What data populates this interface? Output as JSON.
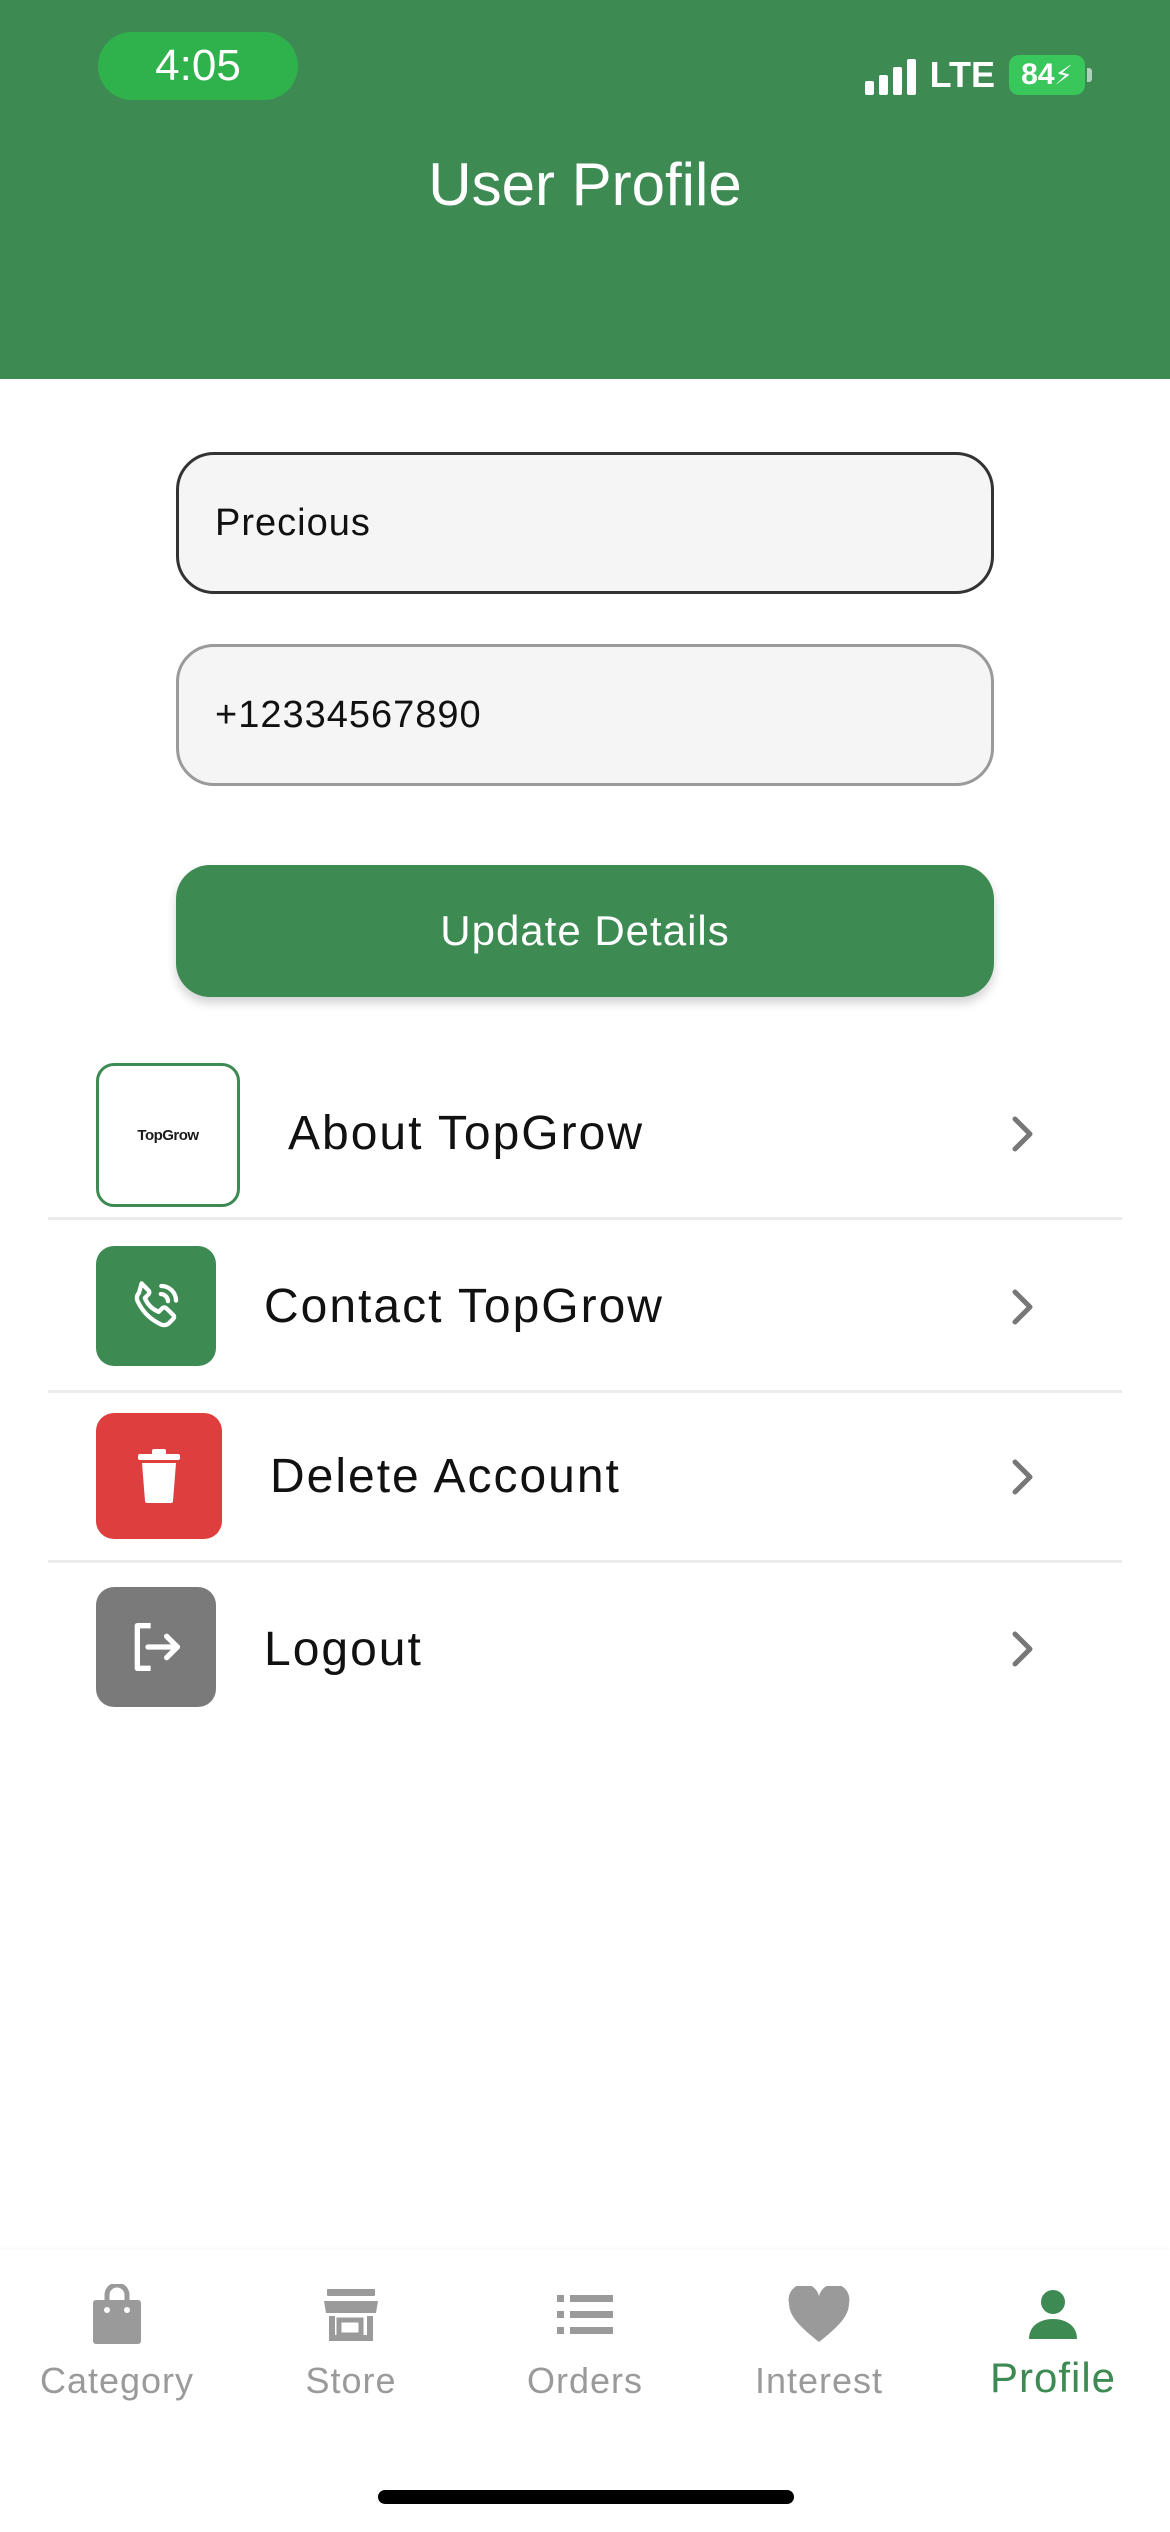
{
  "status_bar": {
    "time": "4:05",
    "network": "LTE",
    "battery": "84"
  },
  "header": {
    "title": "User Profile"
  },
  "form": {
    "name_value": "Precious",
    "phone_value": "+12334567890",
    "update_label": "Update Details"
  },
  "menu": {
    "about": {
      "label": "About TopGrow",
      "logo_text": "TopGrow"
    },
    "contact": {
      "label": "Contact TopGrow"
    },
    "delete": {
      "label": "Delete Account"
    },
    "logout": {
      "label": "Logout"
    }
  },
  "bottom_nav": {
    "items": [
      {
        "label": "Category",
        "icon": "shopping-bag-icon"
      },
      {
        "label": "Store",
        "icon": "store-icon"
      },
      {
        "label": "Orders",
        "icon": "list-icon"
      },
      {
        "label": "Interest",
        "icon": "heart-icon"
      },
      {
        "label": "Profile",
        "icon": "person-icon",
        "active": true
      }
    ]
  },
  "colors": {
    "brand_green": "#3d8a53",
    "danger_red": "#de3e3e",
    "logout_gray": "#7a7a7a",
    "inactive_gray": "#9a9a9a"
  }
}
